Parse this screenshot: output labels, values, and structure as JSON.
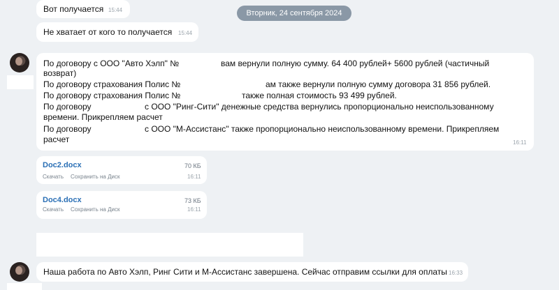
{
  "date_divider": "Вторник, 24 сентября 2024",
  "messages": [
    {
      "text": "Вот получается",
      "time": "15:44"
    },
    {
      "text": "Не хватает от кого то получается",
      "time": "15:44"
    }
  ],
  "long_message": {
    "lines": [
      "По договору с ООО \"Авто Хэлп\" №",
      "вам вернули полную сумму. 64 400 рублей+ 5600 рублей (частичный",
      "возврат)",
      "По договору страхования Полис №",
      "ам также вернули полную сумму договора 31 856 рублей.",
      "По договору страхования Полис №",
      "также полная стоимость 93 499 рублей.",
      "По договору",
      "с ООО \"Ринг-Сити\" денежные средства вернулись пропорционально неиспользованному",
      "времени. Прикрепляем расчет",
      "По договору",
      "с ООО \"М-Ассистанс\" также пропорционально неиспользованному времени. Прикрепляем",
      "расчет"
    ],
    "time": "16:11"
  },
  "files": [
    {
      "name": "Doc2.docx",
      "size": "70 КБ",
      "download": "Скачать",
      "save": "Сохранить на Диск",
      "time": "16:11"
    },
    {
      "name": "Doc4.docx",
      "size": "73 КБ",
      "download": "Скачать",
      "save": "Сохранить на Диск",
      "time": "16:11"
    }
  ],
  "final_message": {
    "text": "Наша работа по Авто Хэлп, Ринг Сити и М-Ассистанс завершена. Сейчас отправим ссылки для оплаты",
    "time": "16:33"
  }
}
